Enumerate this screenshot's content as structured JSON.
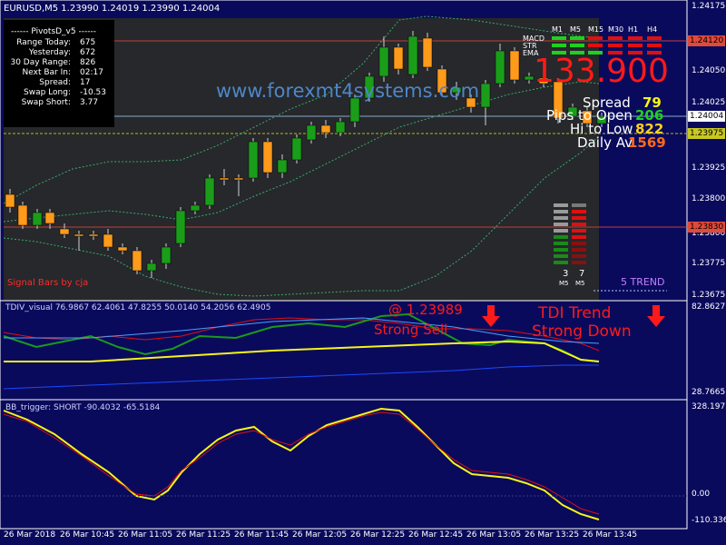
{
  "symbol_line": "EURUSD,M5  1.23990 1.24019 1.23990 1.24004",
  "watermark": "www.forexmt4systems.com",
  "pivots": {
    "title": "------ PivotsD_v5 ------",
    "rows": [
      {
        "label": "Range  Today:",
        "value": "675"
      },
      {
        "label": "Yesterday:",
        "value": "672"
      },
      {
        "label": "30 Day Range:",
        "value": "826"
      },
      {
        "label": "Next Bar In:",
        "value": "02:17"
      },
      {
        "label": "Spread:",
        "value": "17"
      },
      {
        "label": "Swap  Long:",
        "value": "-10.53"
      },
      {
        "label": "Swap  Short:",
        "value": "3.77"
      }
    ]
  },
  "mtf": {
    "timeframes": [
      "M1",
      "M5",
      "M15",
      "M30",
      "H1",
      "H4"
    ],
    "indicators": [
      "MACD",
      "STR",
      "EMA"
    ],
    "cells": [
      [
        "green",
        "green",
        "red",
        "red",
        "red",
        "red"
      ],
      [
        "green",
        "green",
        "red",
        "red",
        "red",
        "red"
      ],
      [
        "green",
        "green",
        "green",
        "red",
        "red",
        "red"
      ]
    ],
    "colors": {
      "green": "#1fd11f",
      "red": "#e01010"
    }
  },
  "info_block": {
    "big_value": "133.900",
    "spread_label": "Spread",
    "spread_value": "79",
    "pips_label": "Pips to Open",
    "pips_value": "206",
    "hilo_label": "Hi to Low",
    "hilo_value": "822",
    "daily_label": "Daily Av",
    "daily_value": "1569"
  },
  "strength": {
    "left_value": "3",
    "right_value": "7",
    "left_tf": "M5",
    "right_tf": "M5"
  },
  "trend_label": "5 TREND",
  "signal_bars_label": "Signal Bars by cja",
  "price_axis": [
    "1.24175",
    "1.24050",
    "1.23925",
    "1.23800",
    "1.23675"
  ],
  "price_axis_full": [
    "1.24175",
    "1.24050",
    "1.23925",
    "1.23800",
    "1.23675",
    "1.24120",
    "1.24004",
    "1.23975",
    "1.23830"
  ],
  "price_tags": {
    "high": "1.24120",
    "current": "1.24004",
    "mid": "1.23975",
    "low": "1.23830"
  },
  "price_ticks": [
    "1.24175",
    "1.24050",
    "1.23925",
    "1.23800",
    "1.23675"
  ],
  "price_ticks_all": [
    "1.24175",
    "1.24050",
    "1.23925",
    "1.23800",
    "1.23675"
  ],
  "price_axis_labels": [
    "1.24175",
    "1.24050",
    "1.23925",
    "1.23800",
    "1.23675"
  ],
  "price_scale": [
    "1.24175",
    "1.24050",
    "1.23925",
    "1.23800",
    "1.23675"
  ],
  "main_axis": [
    "1.24175",
    "1.24050",
    "1.23925",
    "1.23800",
    "1.23675"
  ],
  "main_axis_ticks": [
    "1.24175",
    "1.24050",
    "1.23925",
    "1.23800",
    "1.23675"
  ],
  "axis_values": [
    "1.24175",
    "1.24050",
    "1.23925",
    "1.23800",
    "1.23675"
  ],
  "yaxis": [
    "1.24175",
    "1.24050",
    "1.23925",
    "1.23800",
    "1.23675"
  ],
  "y_ticks": [
    "1.24175",
    "1.24050",
    "1.23925",
    "1.23800",
    "1.23675"
  ],
  "ticks": [
    "1.24175",
    "1.24050",
    "1.23925",
    "1.23800",
    "1.23675"
  ],
  "y_axis_ticks": [
    "1.24175",
    "1.24050",
    "1.23925",
    "1.23800",
    "1.23675"
  ],
  "price_labels": [
    "1.24175",
    "1.24050",
    "1.23925",
    "1.23800",
    "1.23675"
  ],
  "prices": [
    "1.24175",
    "1.24050",
    "1.23925",
    "1.23800",
    "1.23675"
  ],
  "main_prices": [
    "1.24175",
    "1.24050",
    "1.23925",
    "1.23800",
    "1.23675"
  ],
  "main_price_axis": [
    "1.24175",
    "1.24050",
    "1.23925",
    "1.23800",
    "1.23675"
  ],
  "right_axis": [
    "1.24175",
    "1.24050",
    "1.23925",
    "1.23800",
    "1.23675"
  ],
  "p_axis": [
    "1.24175",
    "1.24050",
    "1.23925",
    "1.23800",
    "1.23675"
  ],
  "price_axis_main": [
    "1.24175",
    "1.24050",
    "1.23925",
    "1.23800",
    "1.23675"
  ],
  "axis": [
    "1.24175",
    "1.24050",
    "1.23925",
    "1.23800",
    "1.23675"
  ],
  "y": [
    "1.24175",
    "1.24050",
    "1.23925",
    "1.23800",
    "1.23675"
  ],
  "axis_main": [
    "1.24175",
    "1.24050",
    "1.23925",
    "1.23800",
    "1.23675"
  ],
  "price_axis_list": [
    "1.24175",
    "1.24050",
    "1.23925",
    "1.23800",
    "1.23675"
  ],
  "main_ticks": [
    "1.24175",
    "1.24050",
    "1.23925",
    "1.23800",
    "1.23675"
  ],
  "main_y": [
    "1.24175",
    "1.24050",
    "1.23925",
    "1.23800",
    "1.23675"
  ],
  "main_y_ticks": [
    "1.24175",
    "1.24050",
    "1.23925",
    "1.23800",
    "1.23675"
  ],
  "tdi": {
    "title": "TDIV_visual 76.9867 62.4061 47.8255 50.0140 54.2056 62.4905",
    "axis_top": "82.8627",
    "axis_bottom": "28.7665",
    "signal_price": "@ 1.23989",
    "signal_text": "Strong Sell",
    "trend_line1": "TDI Trend",
    "trend_line2": "Strong Down"
  },
  "bb": {
    "title": "BB_trigger: SHORT -90.4032 -65.5184",
    "axis_top": "328.1975",
    "axis_mid": "0.00",
    "axis_bottom": "-110.3366"
  },
  "time_axis": [
    "26 Mar 2018",
    "26 Mar 10:45",
    "26 Mar 11:05",
    "26 Mar 11:25",
    "26 Mar 11:45",
    "26 Mar 12:05",
    "26 Mar 12:25",
    "26 Mar 12:45",
    "26 Mar 13:05",
    "26 Mar 13:25",
    "26 Mar 13:45"
  ],
  "colors": {
    "bg": "#0a0a5c",
    "main_bg": "#26282b",
    "bull": "#1a9e1a",
    "bear": "#ff9a1a",
    "signal_red": "#ff1a1a",
    "yellow": "#f5f51a"
  }
}
